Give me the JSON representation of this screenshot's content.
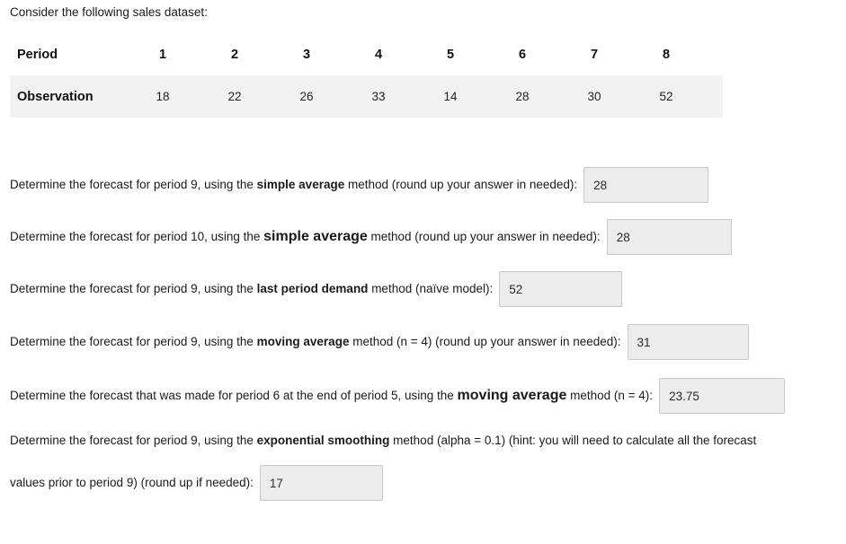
{
  "intro": "Consider the following sales dataset:",
  "dataset": {
    "period_label": "Period",
    "observation_label": "Observation",
    "periods": [
      "1",
      "2",
      "3",
      "4",
      "5",
      "6",
      "7",
      "8"
    ],
    "observations": [
      "18",
      "22",
      "26",
      "33",
      "14",
      "28",
      "30",
      "52"
    ]
  },
  "questions": [
    {
      "id": "q1",
      "pre": "Determine the forecast for period 9, using the ",
      "method": "simple average",
      "post": " method (round up your answer in needed):",
      "answer": "28",
      "emphasis": "normal"
    },
    {
      "id": "q2",
      "pre": "Determine the forecast for period 10, using the ",
      "method": "simple average",
      "post": " method (round up your answer in needed):",
      "answer": "28",
      "emphasis": "large"
    },
    {
      "id": "q3",
      "pre": "Determine the forecast for period 9, using the ",
      "method": "last period demand",
      "post": " method (naïve model):",
      "answer": "52",
      "emphasis": "normal"
    },
    {
      "id": "q4",
      "pre": "Determine the forecast for period 9, using the ",
      "method": "moving average",
      "post": " method (n = 4) (round up your answer in needed):",
      "answer": "31",
      "emphasis": "normal"
    },
    {
      "id": "q5",
      "pre": "Determine the forecast that was made for period 6 at the end of period 5, using the ",
      "method": "moving average",
      "post": " method (n = 4):",
      "answer": "23.75",
      "emphasis": "large"
    },
    {
      "id": "q6",
      "pre": "Determine the forecast for period 9, using the ",
      "method": "exponential smoothing",
      "post": " method (alpha = 0.1) (hint: you will need to calculate all the forecast",
      "post_line2": "values prior to period 9) (round up if needed):",
      "answer": "17",
      "emphasis": "normal"
    }
  ],
  "colors": {
    "table_row_bg": "#f1f1f1",
    "input_bg": "#ececec",
    "input_border": "#c8c8c8",
    "text": "#1a1a1a"
  }
}
